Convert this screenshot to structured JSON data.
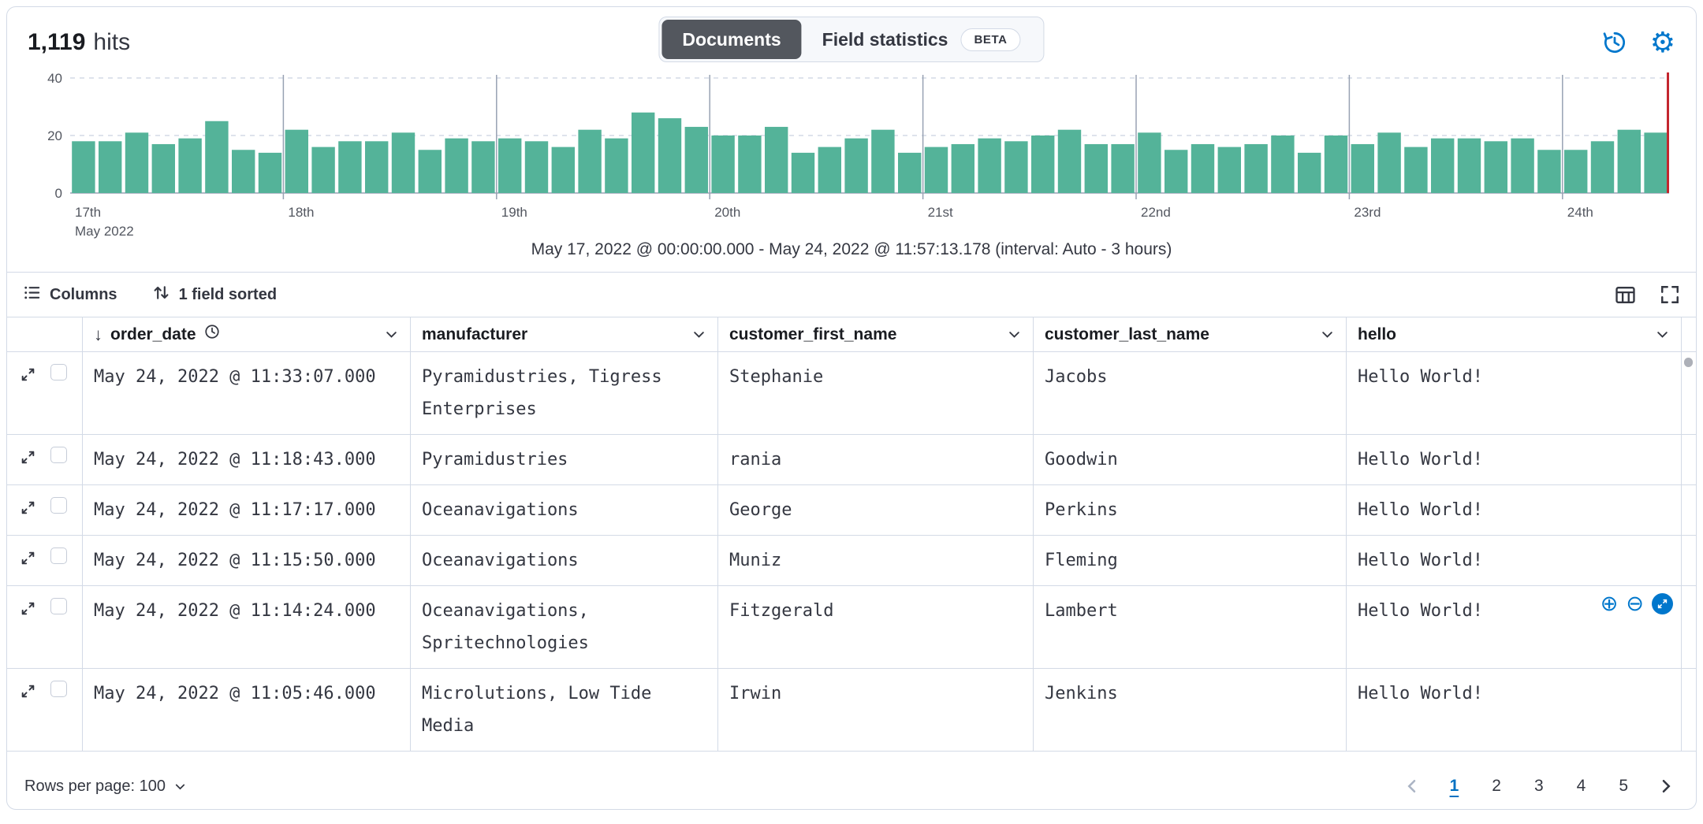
{
  "header": {
    "hits_count": "1,119",
    "hits_label": "hits",
    "tabs": [
      {
        "label": "Documents",
        "selected": true
      },
      {
        "label": "Field statistics",
        "selected": false,
        "badge": "BETA"
      }
    ]
  },
  "chart_data": {
    "type": "bar",
    "title": "",
    "xlabel": "",
    "ylabel": "",
    "ylim": [
      0,
      40
    ],
    "yticks": [
      0,
      20,
      40
    ],
    "bar_color": "#54B399",
    "grid": true,
    "values": [
      18,
      18,
      21,
      17,
      19,
      25,
      15,
      14,
      22,
      16,
      18,
      18,
      21,
      15,
      19,
      18,
      19,
      18,
      16,
      22,
      19,
      28,
      26,
      23,
      20,
      20,
      23,
      14,
      16,
      19,
      22,
      14,
      16,
      17,
      19,
      18,
      20,
      22,
      17,
      17,
      21,
      15,
      17,
      16,
      17,
      20,
      14,
      20,
      17,
      21,
      16,
      19,
      19,
      18,
      19,
      15,
      15,
      18,
      22,
      21
    ],
    "x_ticks": [
      {
        "index": 0,
        "label": "17th",
        "sublabel": "May 2022"
      },
      {
        "index": 8,
        "label": "18th"
      },
      {
        "index": 16,
        "label": "19th"
      },
      {
        "index": 24,
        "label": "20th"
      },
      {
        "index": 32,
        "label": "21st"
      },
      {
        "index": 40,
        "label": "22nd"
      },
      {
        "index": 48,
        "label": "23rd"
      },
      {
        "index": 56,
        "label": "24th"
      }
    ],
    "current_time_marker_color": "#C4262E",
    "caption": "May 17, 2022 @ 00:00:00.000 - May 24, 2022 @ 11:57:13.178 (interval: Auto - 3 hours)"
  },
  "toolbar": {
    "columns_label": "Columns",
    "sort_label": "1 field sorted"
  },
  "table": {
    "columns": [
      {
        "id": "order_date",
        "label": "order_date",
        "sorted": "desc",
        "time_field": true
      },
      {
        "id": "manufacturer",
        "label": "manufacturer"
      },
      {
        "id": "customer_first_name",
        "label": "customer_first_name"
      },
      {
        "id": "customer_last_name",
        "label": "customer_last_name"
      },
      {
        "id": "hello",
        "label": "hello"
      }
    ],
    "rows": [
      {
        "order_date": "May 24, 2022 @ 11:33:07.000",
        "manufacturer": "Pyramidustries, Tigress Enterprises",
        "customer_first_name": "Stephanie",
        "customer_last_name": "Jacobs",
        "hello": "Hello World!"
      },
      {
        "order_date": "May 24, 2022 @ 11:18:43.000",
        "manufacturer": "Pyramidustries",
        "customer_first_name": "rania",
        "customer_last_name": "Goodwin",
        "hello": "Hello World!"
      },
      {
        "order_date": "May 24, 2022 @ 11:17:17.000",
        "manufacturer": "Oceanavigations",
        "customer_first_name": "George",
        "customer_last_name": "Perkins",
        "hello": "Hello World!"
      },
      {
        "order_date": "May 24, 2022 @ 11:15:50.000",
        "manufacturer": "Oceanavigations",
        "customer_first_name": "Muniz",
        "customer_last_name": "Fleming",
        "hello": "Hello World!"
      },
      {
        "order_date": "May 24, 2022 @ 11:14:24.000",
        "manufacturer": "Oceanavigations, Spritechnologies",
        "customer_first_name": "Fitzgerald",
        "customer_last_name": "Lambert",
        "hello": "Hello World!",
        "cell_actions": [
          "filter-for",
          "filter-out",
          "expand-cell"
        ]
      },
      {
        "order_date": "May 24, 2022 @ 11:05:46.000",
        "manufacturer": "Microlutions, Low Tide Media",
        "customer_first_name": "Irwin",
        "customer_last_name": "Jenkins",
        "hello": "Hello World!"
      }
    ]
  },
  "footer": {
    "rows_per_page_label": "Rows per page: 100",
    "pages": [
      "1",
      "2",
      "3",
      "4",
      "5"
    ],
    "active_page": "1",
    "prev_enabled": false,
    "next_enabled": true
  },
  "colors": {
    "accent_blue": "#0077CC",
    "active_page_blue": "#0071C2",
    "bar_green": "#54B399",
    "marker_red": "#C4262E",
    "selected_tab_bg": "#53575E",
    "border": "#D3DAE6"
  }
}
